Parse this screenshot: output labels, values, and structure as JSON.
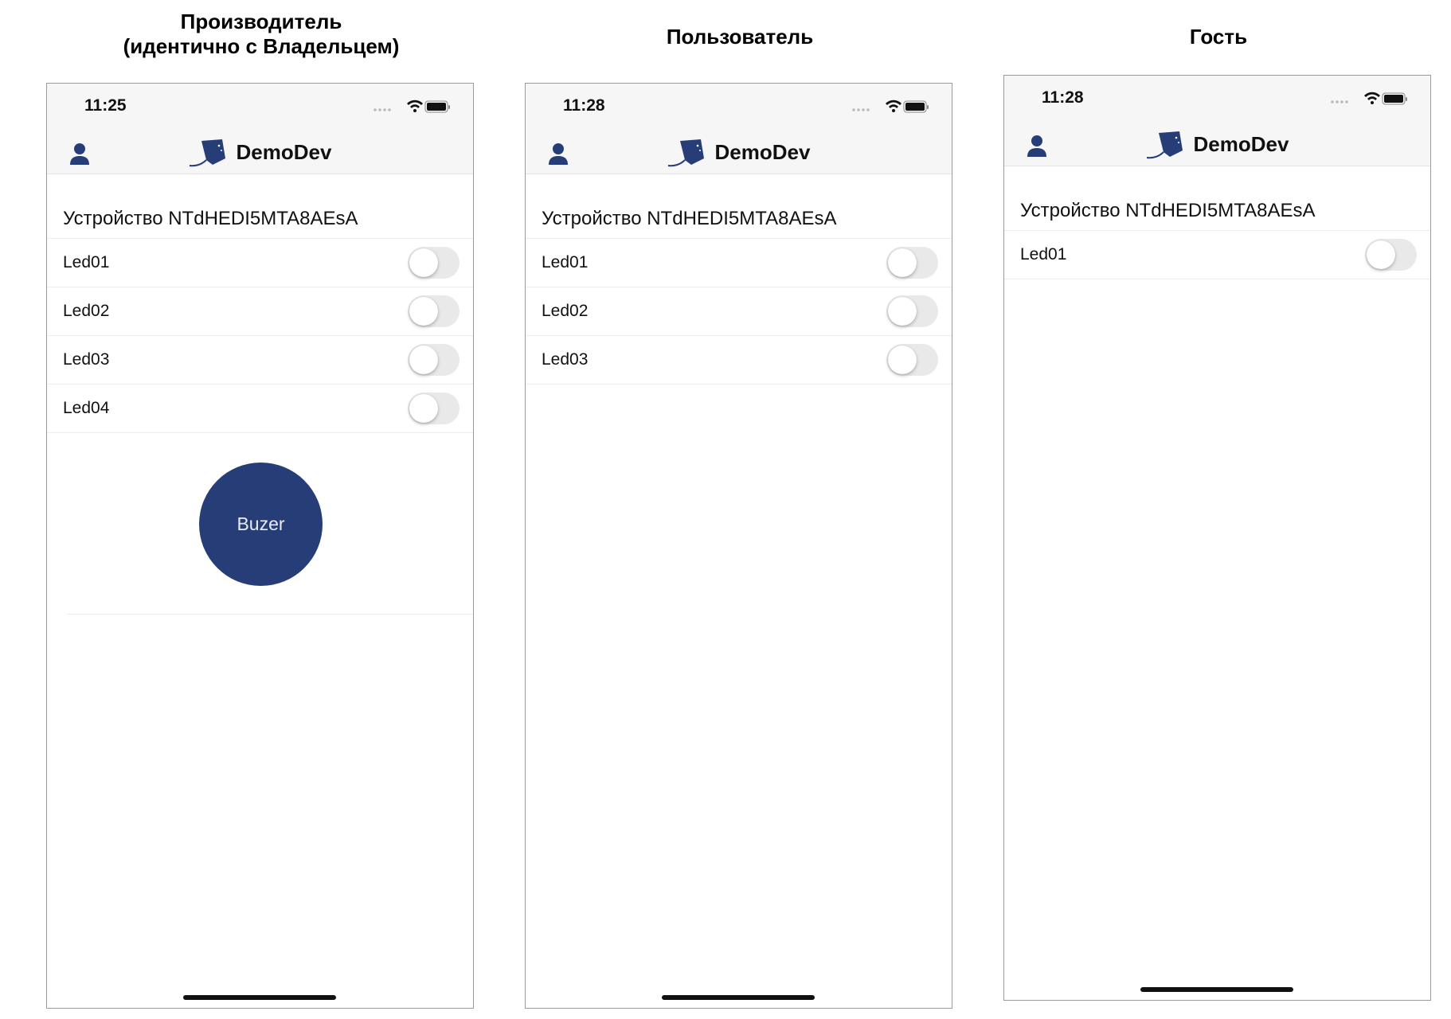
{
  "columns": [
    {
      "title_line1": "Производитель",
      "title_line2": "(идентично с Владельцем)",
      "time": "11:25",
      "app_name": "DemoDev",
      "device_title": "Устройство NTdHEDI5MTA8AEsA",
      "leds": [
        {
          "label": "Led01",
          "on": false
        },
        {
          "label": "Led02",
          "on": false
        },
        {
          "label": "Led03",
          "on": false
        },
        {
          "label": "Led04",
          "on": false
        }
      ],
      "buzer_label": "Buzer"
    },
    {
      "title_line1": "Пользователь",
      "time": "11:28",
      "app_name": "DemoDev",
      "device_title": "Устройство NTdHEDI5MTA8AEsA",
      "leds": [
        {
          "label": "Led01",
          "on": false
        },
        {
          "label": "Led02",
          "on": false
        },
        {
          "label": "Led03",
          "on": false
        }
      ]
    },
    {
      "title_line1": "Гость",
      "time": "11:28",
      "app_name": "DemoDev",
      "device_title": "Устройство NTdHEDI5MTA8AEsA",
      "leds": [
        {
          "label": "Led01",
          "on": false
        }
      ]
    }
  ],
  "colors": {
    "accent": "#263d78",
    "navbar_bg": "#f6f6f6",
    "toggle_off": "#e9e9ea"
  },
  "icons": {
    "user": "person-icon",
    "logo": "stingray-logo-icon",
    "signal": "cellular-signal-icon",
    "wifi": "wifi-icon",
    "battery": "battery-icon"
  }
}
